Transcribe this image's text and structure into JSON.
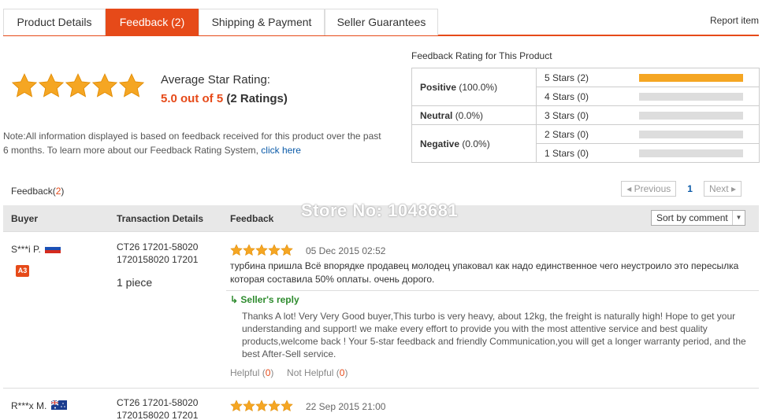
{
  "tabs": [
    {
      "label": "Product Details"
    },
    {
      "label": "Feedback (2)"
    },
    {
      "label": "Shipping & Payment"
    },
    {
      "label": "Seller Guarantees"
    }
  ],
  "report_label": "Report item",
  "summary": {
    "title": "Average Star Rating:",
    "value": "5.0 out of 5",
    "count": "(2 Ratings)",
    "stars": 5,
    "note": "Note:All information displayed is based on feedback received for this product over the past 6 months. To learn more about our Feedback Rating System,",
    "note_link": "click here"
  },
  "rating_table": {
    "title": "Feedback Rating for This Product",
    "positive": {
      "label": "Positive",
      "pct": "(100.0%)"
    },
    "neutral": {
      "label": "Neutral",
      "pct": "(0.0%)"
    },
    "negative": {
      "label": "Negative",
      "pct": "(0.0%)"
    },
    "bars": [
      {
        "label": "5 Stars (2)",
        "fraction": 1.0
      },
      {
        "label": "4 Stars (0)",
        "fraction": 0
      },
      {
        "label": "3 Stars (0)",
        "fraction": 0
      },
      {
        "label": "2 Stars (0)",
        "fraction": 0
      },
      {
        "label": "1 Stars (0)",
        "fraction": 0
      }
    ]
  },
  "list": {
    "title": "Feedback(",
    "count": "2",
    "close": ")",
    "pager": {
      "prev": "Previous",
      "current": "1",
      "next": "Next"
    },
    "headers": {
      "buyer": "Buyer",
      "transaction": "Transaction Details",
      "feedback": "Feedback"
    },
    "sort": "Sort by comment",
    "watermark": "Store No: 1048681"
  },
  "reviews": [
    {
      "buyer": "S***i P.",
      "badge": "A3",
      "transaction": "CT26 17201-58020 1720158020 17201",
      "quantity": "1 piece",
      "stars": 5,
      "date": "05 Dec 2015 02:52",
      "text": "турбина пришла Всё впорядке продавец молодец упаковал как надо единственное чего неустроило это пересылка которая составила 50% оплаты. очень дорого.",
      "reply_label": "Seller's reply",
      "reply": "Thanks A lot! Very Very Good buyer,This turbo is very heavy, about 12kg, the freight is naturally high! Hope to get your understanding and support! we make every effort to provide you with the most attentive service and best quality products,welcome back ! Your 5-star feedback and friendly Communication,you will get a longer warranty period, and the best After-Sell service.",
      "helpful": "Helpful (",
      "helpful_n": "0",
      "not_helpful": "Not Helpful (",
      "not_helpful_n": "0",
      "close": ")"
    },
    {
      "buyer": "R***x M.",
      "transaction": "CT26 17201-58020 1720158020 17201",
      "stars": 5,
      "date": "22 Sep 2015 21:00"
    }
  ],
  "colors": {
    "accent": "#e64a19",
    "star": "#f5a623",
    "link": "#0a5aa8",
    "reply": "#2e8b2e"
  }
}
